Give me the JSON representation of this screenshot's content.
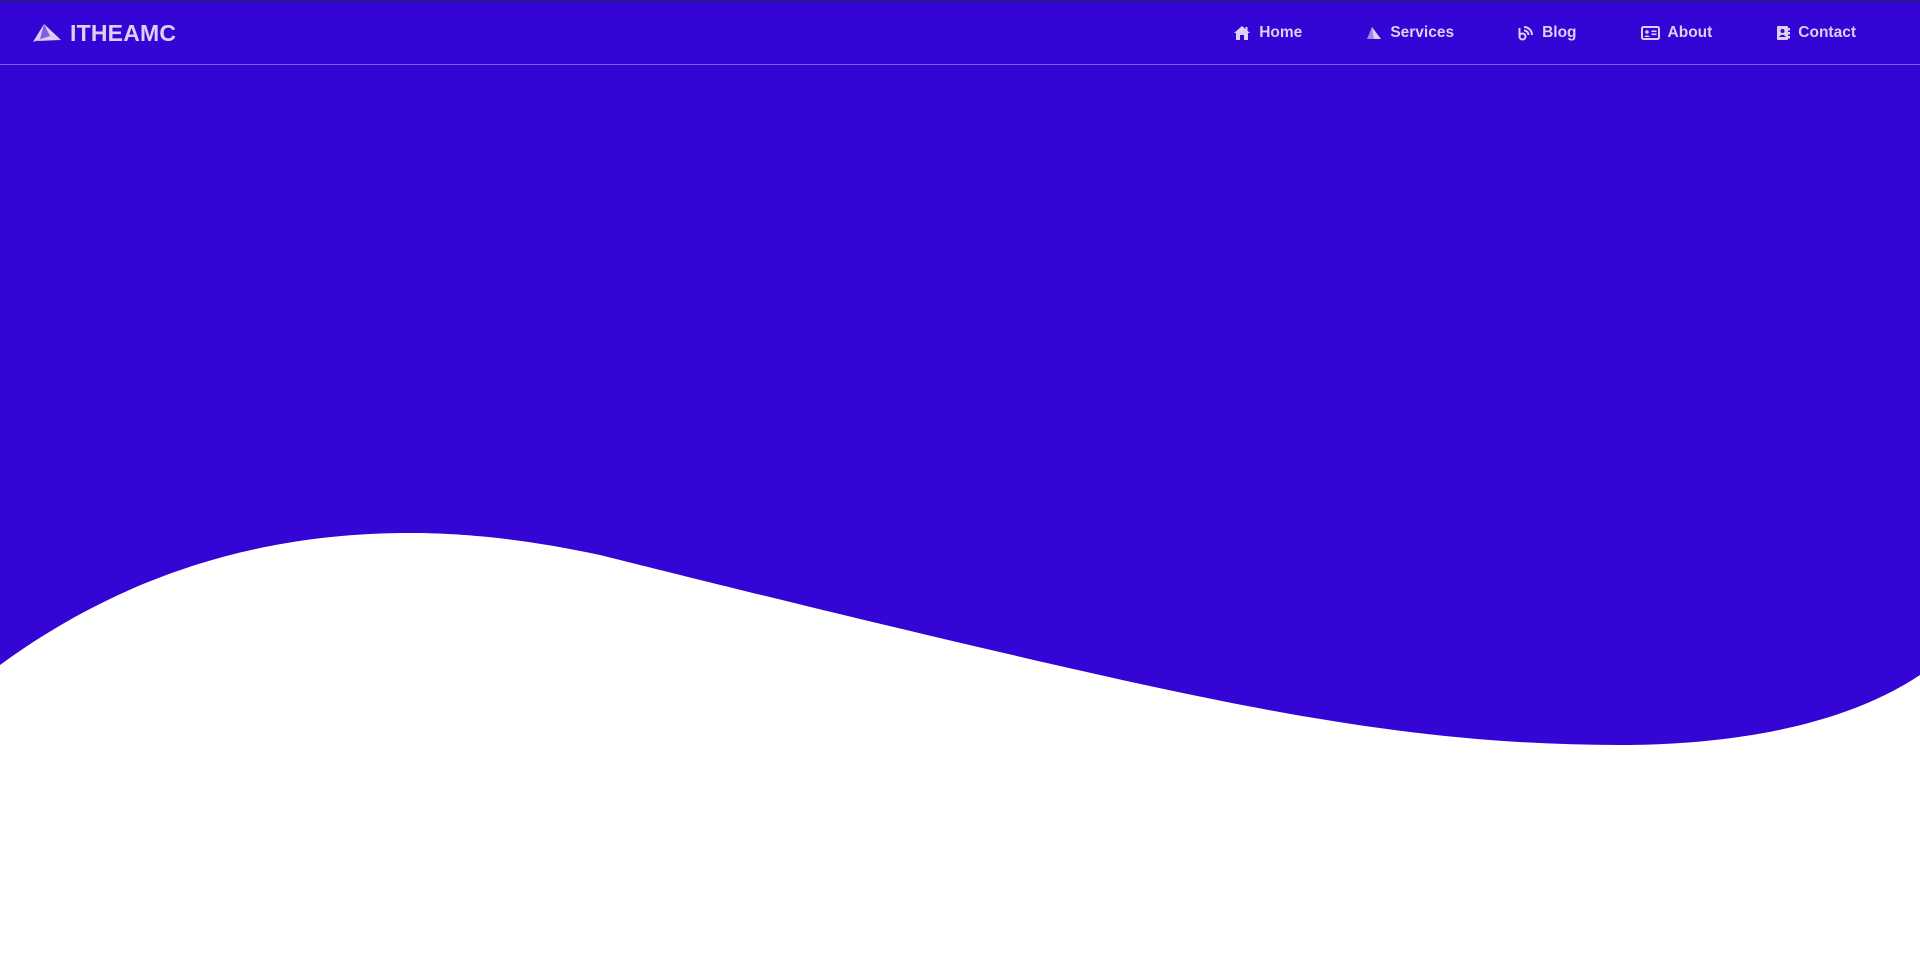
{
  "colors": {
    "hero_background": "#3405d4",
    "nav_text": "#dcd0f7",
    "page_background": "#ffffff"
  },
  "brand": {
    "name": "ITHEAMC",
    "icon": "paper-plane-icon"
  },
  "nav": {
    "items": [
      {
        "label": "Home",
        "icon": "home-icon"
      },
      {
        "label": "Services",
        "icon": "send-icon"
      },
      {
        "label": "Blog",
        "icon": "blog-icon"
      },
      {
        "label": "About",
        "icon": "id-card-icon"
      },
      {
        "label": "Contact",
        "icon": "address-book-icon"
      }
    ]
  }
}
